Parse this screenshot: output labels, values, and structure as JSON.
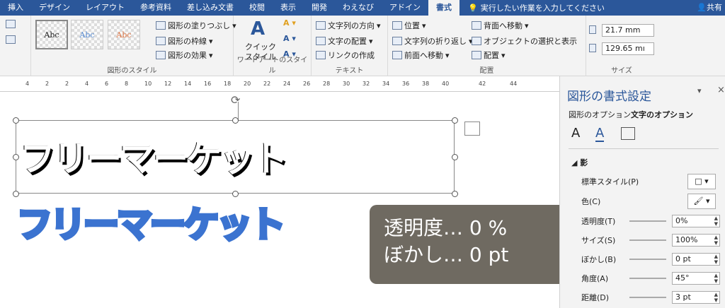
{
  "tabs": [
    "挿入",
    "デザイン",
    "レイアウト",
    "参考資料",
    "差し込み文書",
    "校閲",
    "表示",
    "開発",
    "わえなび",
    "アドイン",
    "書式"
  ],
  "active_tab": "書式",
  "tell_me": "実行したい作業を入力してください",
  "share": "共有",
  "shape_styles": {
    "sample": "Abc",
    "fill": "図形の塗りつぶし",
    "outline": "図形の枠線",
    "effects": "図形の効果",
    "label": "図形のスタイル"
  },
  "wordart": {
    "quick": "クイック",
    "quick2": "スタイル",
    "label": "ワードアートのスタイル"
  },
  "text_group": {
    "direction": "文字列の方向",
    "align": "文字の配置",
    "link": "リンクの作成",
    "label": "テキスト"
  },
  "arrange": {
    "position": "位置",
    "wrap": "文字列の折り返し",
    "forward": "前面へ移動",
    "backward": "背面へ移動",
    "selection": "オブジェクトの選択と表示",
    "align": "配置",
    "label": "配置"
  },
  "size": {
    "height": "21.7 mm",
    "width": "129.65 mı",
    "label": "サイズ"
  },
  "ruler_ticks": [
    "4",
    "2",
    "2",
    "4",
    "6",
    "8",
    "10",
    "12",
    "14",
    "16",
    "18",
    "20",
    "22",
    "24",
    "26",
    "28",
    "30",
    "32",
    "34",
    "36",
    "38",
    "40",
    "42",
    "44"
  ],
  "doc": {
    "ghost_text": "フリーマーケット",
    "blue_text": "フリーマーケット"
  },
  "caption": {
    "line1": "透明度… 0 %",
    "line2": "ぼかし… 0 pt"
  },
  "pane": {
    "title": "図形の書式設定",
    "tab_shape": "図形のオプション",
    "tab_text": "文字のオプション",
    "section": "影",
    "preset": "標準スタイル(P)",
    "color": "色(C)",
    "rows": [
      {
        "label": "透明度(T)",
        "value": "0%"
      },
      {
        "label": "サイズ(S)",
        "value": "100%"
      },
      {
        "label": "ぼかし(B)",
        "value": "0 pt"
      },
      {
        "label": "角度(A)",
        "value": "45°"
      },
      {
        "label": "距離(D)",
        "value": "3 pt"
      }
    ]
  }
}
